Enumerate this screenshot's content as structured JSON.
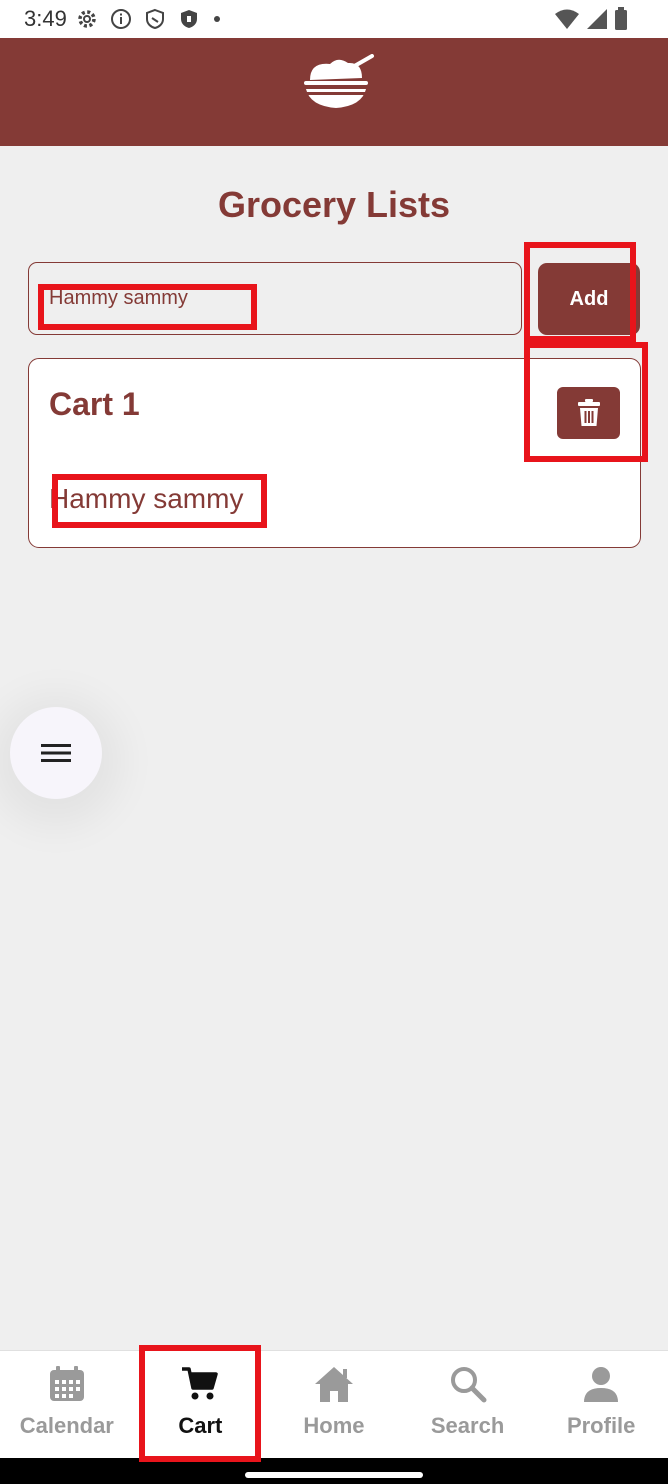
{
  "status_bar": {
    "time": "3:49",
    "icons_left": [
      "gear-icon",
      "info-icon",
      "shield-icon",
      "shield-filled-icon",
      "dot-icon"
    ],
    "icons_right": [
      "wifi-icon",
      "signal-icon",
      "battery-icon"
    ]
  },
  "app_bar": {
    "logo_icon": "rice-bowl-logo",
    "bg_color": "#843a36"
  },
  "page": {
    "title": "Grocery Lists",
    "input_value": "Hammy sammy",
    "add_label": "Add"
  },
  "lists": [
    {
      "name": "Cart 1",
      "items": [
        "Hammy sammy"
      ]
    }
  ],
  "fab": {
    "icon": "menu-icon"
  },
  "bottom_nav": {
    "items": [
      {
        "label": "Calendar",
        "icon": "calendar-icon",
        "active": false
      },
      {
        "label": "Cart",
        "icon": "cart-icon",
        "active": true
      },
      {
        "label": "Home",
        "icon": "home-icon",
        "active": false
      },
      {
        "label": "Search",
        "icon": "search-icon",
        "active": false
      },
      {
        "label": "Profile",
        "icon": "profile-icon",
        "active": false
      }
    ]
  },
  "colors": {
    "accent": "#843a36",
    "background": "#efefef",
    "highlight": "#e8141b"
  }
}
